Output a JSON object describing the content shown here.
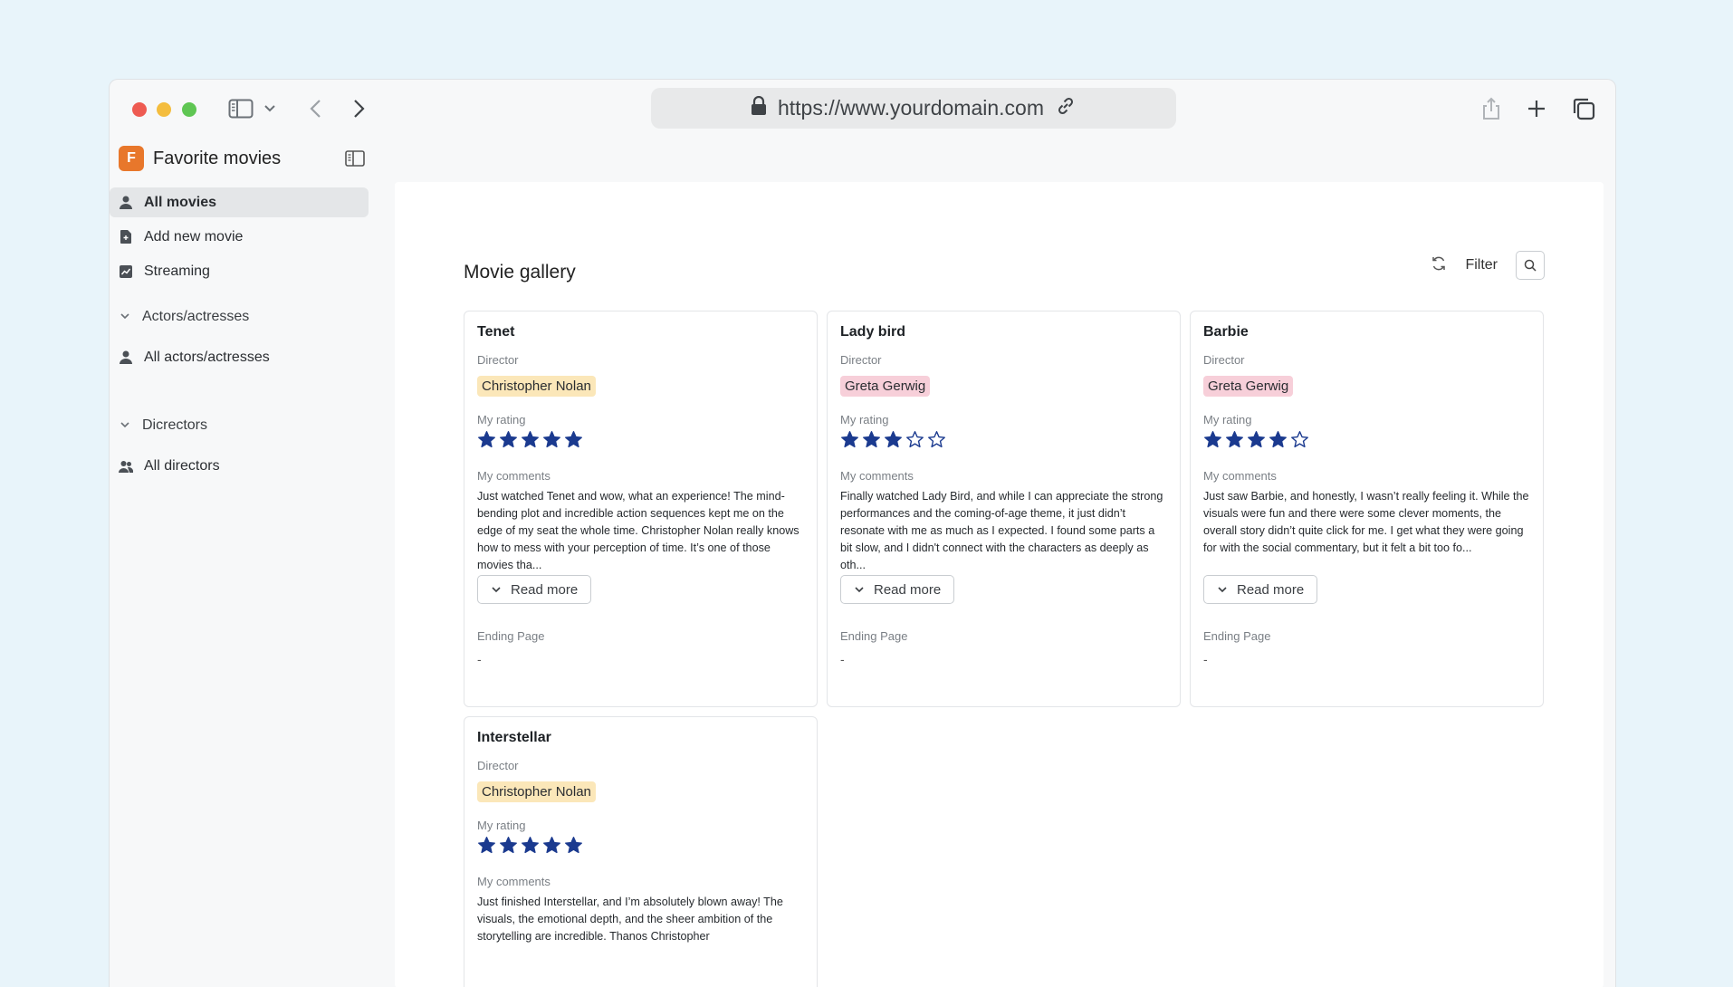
{
  "browser": {
    "url": "https://www.yourdomain.com"
  },
  "app": {
    "badge": "F",
    "title": "Favorite movies"
  },
  "sidebar": {
    "items": [
      {
        "label": "All movies",
        "icon": "person-icon",
        "active": true
      },
      {
        "label": "Add new movie",
        "icon": "document-add-icon"
      },
      {
        "label": "Streaming",
        "icon": "chart-icon"
      }
    ],
    "sections": [
      {
        "label": "Actors/actresses",
        "items": [
          {
            "label": "All actors/actresses",
            "icon": "person-icon"
          }
        ]
      },
      {
        "label": "Dicrectors",
        "items": [
          {
            "label": "All directors",
            "icon": "people-icon"
          }
        ]
      }
    ]
  },
  "main": {
    "title": "Movie gallery",
    "filter_label": "Filter",
    "labels": {
      "director": "Director",
      "rating": "My rating",
      "comments": "My comments",
      "read_more": "Read more",
      "ending": "Ending Page"
    },
    "movies": [
      {
        "title": "Tenet",
        "director": "Christopher Nolan",
        "chip_color": "#fbe7b9",
        "rating": 5,
        "comment": "Just watched Tenet and wow, what an experience! The mind-bending plot and incredible action sequences kept me on the edge of my seat the whole time. Christopher Nolan really knows how to mess with your perception of time. It’s one of those movies tha...",
        "ending": "-"
      },
      {
        "title": "Lady bird",
        "director": "Greta Gerwig",
        "chip_color": "#f7cfd9",
        "rating": 3,
        "comment": "Finally watched Lady Bird, and while I can appreciate the strong performances and the coming-of-age theme, it just didn’t resonate with me as much as I expected. I found some parts a bit slow, and I didn't connect with the characters as deeply as oth...",
        "ending": "-"
      },
      {
        "title": "Barbie",
        "director": "Greta Gerwig",
        "chip_color": "#f7cfd9",
        "rating": 4,
        "comment": "Just saw Barbie, and honestly, I wasn’t really feeling it. While the visuals were fun and there were some clever moments, the overall story didn’t quite click for me. I get what they were going for with the social commentary, but it felt a bit too fo...",
        "ending": "-"
      },
      {
        "title": "Interstellar",
        "director": "Christopher Nolan",
        "chip_color": "#fbe7b9",
        "rating": 5,
        "comment": "Just finished Interstellar, and I’m absolutely blown away! The visuals, the emotional depth, and the sheer ambition of the storytelling are incredible. Thanos Christopher",
        "ending": "-"
      }
    ]
  }
}
